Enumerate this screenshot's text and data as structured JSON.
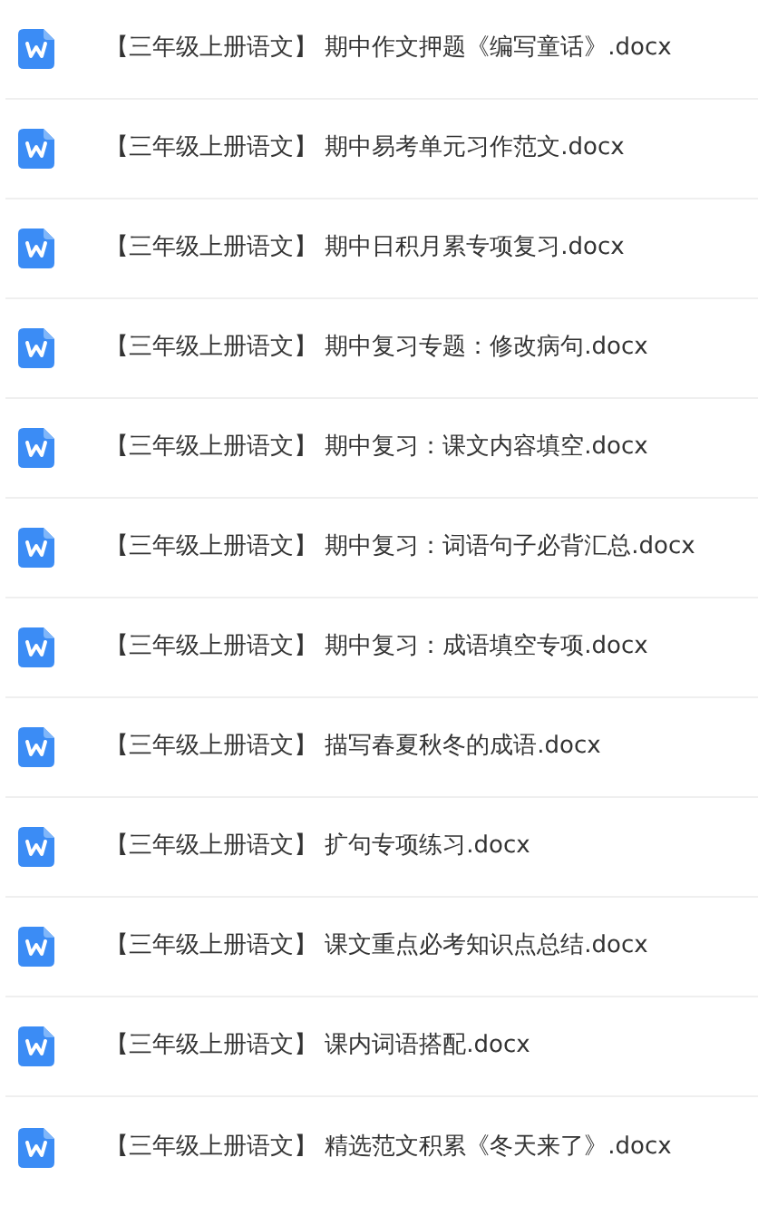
{
  "files": [
    {
      "name": "【三年级上册语文】 期中作文押题《编写童话》.docx"
    },
    {
      "name": "【三年级上册语文】 期中易考单元习作范文.docx"
    },
    {
      "name": "【三年级上册语文】 期中日积月累专项复习.docx"
    },
    {
      "name": "【三年级上册语文】 期中复习专题：修改病句.docx"
    },
    {
      "name": "【三年级上册语文】 期中复习：课文内容填空.docx"
    },
    {
      "name": "【三年级上册语文】 期中复习：词语句子必背汇总.docx"
    },
    {
      "name": "【三年级上册语文】 期中复习：成语填空专项.docx"
    },
    {
      "name": "【三年级上册语文】 描写春夏秋冬的成语.docx"
    },
    {
      "name": "【三年级上册语文】 扩句专项练习.docx"
    },
    {
      "name": "【三年级上册语文】 课文重点必考知识点总结.docx"
    },
    {
      "name": "【三年级上册语文】 课内词语搭配.docx"
    },
    {
      "name": "【三年级上册语文】 精选范文积累《冬天来了》.docx"
    }
  ]
}
